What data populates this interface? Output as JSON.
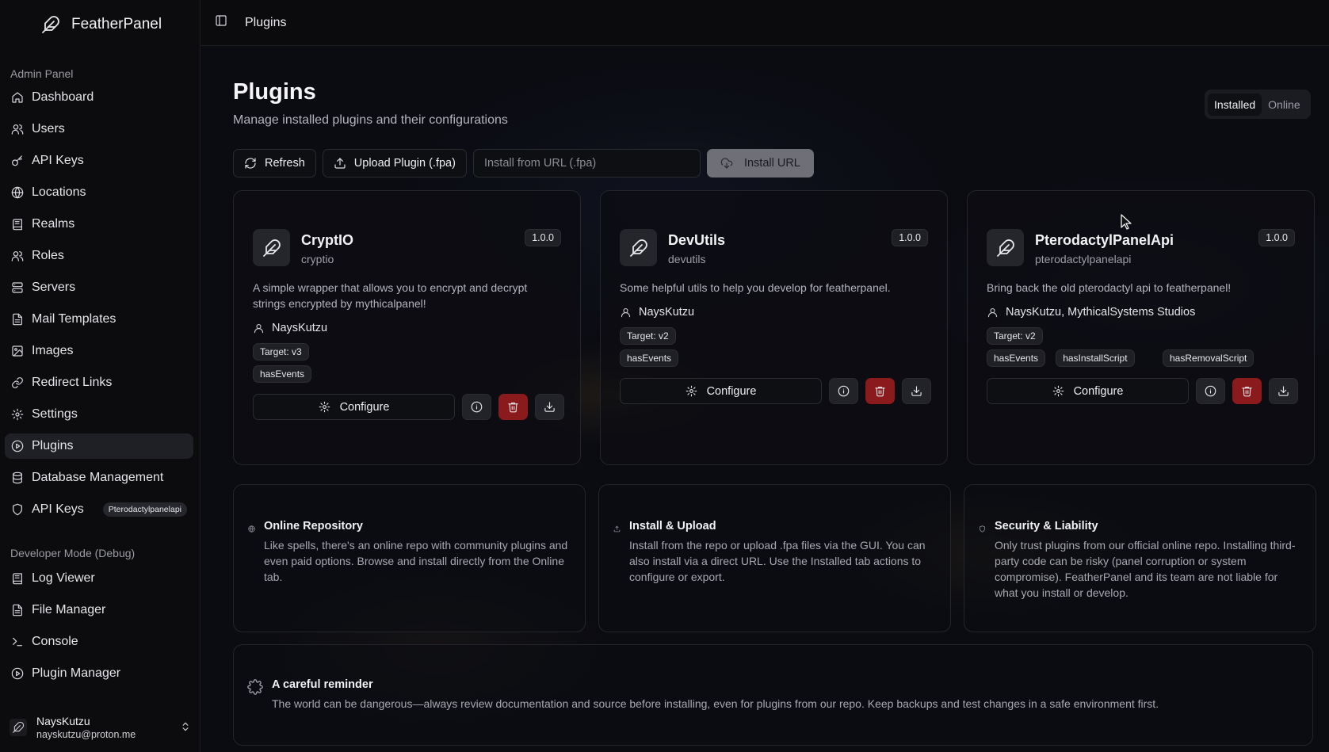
{
  "app": {
    "name": "FeatherPanel"
  },
  "sidebar": {
    "admin_label": "Admin Panel",
    "items": [
      {
        "label": "Dashboard",
        "icon": "home-icon"
      },
      {
        "label": "Users",
        "icon": "users-icon"
      },
      {
        "label": "API Keys",
        "icon": "key-icon"
      },
      {
        "label": "Locations",
        "icon": "globe-icon"
      },
      {
        "label": "Realms",
        "icon": "book-icon"
      },
      {
        "label": "Roles",
        "icon": "users-icon"
      },
      {
        "label": "Servers",
        "icon": "server-icon"
      },
      {
        "label": "Mail Templates",
        "icon": "file-icon"
      },
      {
        "label": "Images",
        "icon": "image-icon"
      },
      {
        "label": "Redirect Links",
        "icon": "link-icon"
      },
      {
        "label": "Settings",
        "icon": "gear-icon"
      },
      {
        "label": "Plugins",
        "icon": "plug-icon",
        "active": true
      },
      {
        "label": "Database Management",
        "icon": "database-icon"
      },
      {
        "label": "API Keys",
        "icon": "shield-icon",
        "badge": "Pterodactylpanelapi"
      }
    ],
    "dev_label": "Developer Mode (Debug)",
    "dev_items": [
      {
        "label": "Log Viewer",
        "icon": "book-icon"
      },
      {
        "label": "File Manager",
        "icon": "file-icon"
      },
      {
        "label": "Console",
        "icon": "terminal-icon"
      },
      {
        "label": "Plugin Manager",
        "icon": "play-circle-icon"
      }
    ],
    "user": {
      "name": "NaysKutzu",
      "email": "nayskutzu@proton.me"
    }
  },
  "topbar": {
    "title": "Plugins"
  },
  "page": {
    "title": "Plugins",
    "subtitle": "Manage installed plugins and their configurations",
    "tabs": {
      "installed": "Installed",
      "online": "Online",
      "active": "installed"
    }
  },
  "toolbar": {
    "refresh": "Refresh",
    "upload": "Upload Plugin (.fpa)",
    "url_placeholder": "Install from URL (.fpa)",
    "url_value": "",
    "install": "Install URL"
  },
  "plugins": [
    {
      "name": "CryptIO",
      "slug": "cryptio",
      "version": "1.0.0",
      "description": "A simple wrapper that allows you to encrypt and decrypt strings encrypted by mythicalpanel!",
      "author": "NaysKutzu",
      "target": "Target: v3",
      "flags": [
        "hasEvents"
      ],
      "configure": "Configure"
    },
    {
      "name": "DevUtils",
      "slug": "devutils",
      "version": "1.0.0",
      "description": "Some helpful utils to help you develop for featherpanel.",
      "author": "NaysKutzu",
      "target": "Target: v2",
      "flags": [
        "hasEvents"
      ],
      "configure": "Configure"
    },
    {
      "name": "PterodactylPanelApi",
      "slug": "pterodactylpanelapi",
      "version": "1.0.0",
      "description": "Bring back the old pterodactyl api to featherpanel!",
      "author": "NaysKutzu, MythicalSystems Studios",
      "target": "Target: v2",
      "flags": [
        "hasEvents",
        "hasInstallScript",
        "hasRemovalScript"
      ],
      "configure": "Configure"
    }
  ],
  "info": [
    {
      "title": "Online Repository",
      "text": "Like spells, there's an online repo with community plugins and even paid options. Browse and install directly from the Online tab.",
      "icon": "globe-icon"
    },
    {
      "title": "Install & Upload",
      "text": "Install from the repo or upload .fpa files via the GUI. You can also install via a direct URL. Use the Installed tab actions to configure or export.",
      "icon": "upload-icon"
    },
    {
      "title": "Security & Liability",
      "text": "Only trust plugins from our official online repo. Installing third-party code can be risky (panel corruption or system compromise). FeatherPanel and its team are not liable for what you install or develop.",
      "icon": "shield-icon"
    }
  ],
  "reminder": {
    "title": "A careful reminder",
    "text": "The world can be dangerous—always review documentation and source before installing, even for plugins from our repo. Keep backups and test changes in a safe environment first."
  },
  "colors": {
    "danger": "#8a1a1c",
    "active_nav": "#1f2025",
    "background": "#0b0c12"
  }
}
